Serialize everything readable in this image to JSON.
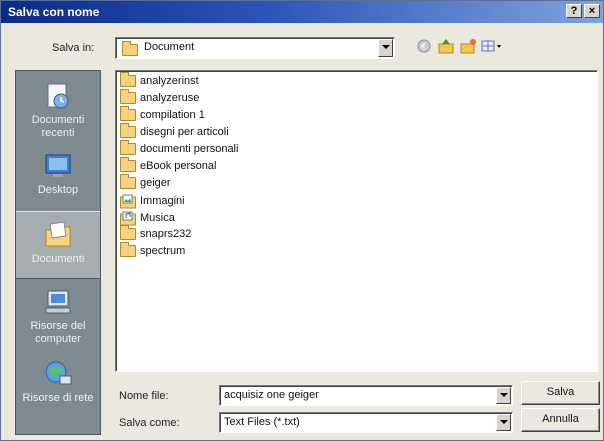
{
  "window": {
    "title": "Salva con nome",
    "help_btn": "?",
    "close_btn": "×"
  },
  "toolbar": {
    "save_in_label": "Salva in:",
    "save_in_value": "Document",
    "icons": [
      "back-icon",
      "up-folder-icon",
      "new-folder-icon",
      "views-menu-icon"
    ]
  },
  "places": [
    {
      "label": "Documenti recenti",
      "icon": "recent-documents-icon"
    },
    {
      "label": "Desktop",
      "icon": "desktop-icon"
    },
    {
      "label": "Documenti",
      "icon": "my-documents-icon"
    },
    {
      "label": "Risorse del computer",
      "icon": "my-computer-icon"
    },
    {
      "label": "Risorse di rete",
      "icon": "network-places-icon"
    }
  ],
  "files": [
    {
      "name": "analyzerinst",
      "icon": "folder-icon"
    },
    {
      "name": "analyzeruse",
      "icon": "folder-icon"
    },
    {
      "name": "compilation 1",
      "icon": "folder-icon"
    },
    {
      "name": "disegni per articoli",
      "icon": "folder-icon"
    },
    {
      "name": "documenti personali",
      "icon": "folder-icon"
    },
    {
      "name": "eBook personal",
      "icon": "folder-icon"
    },
    {
      "name": "geiger",
      "icon": "folder-icon"
    },
    {
      "name": "Immagini",
      "icon": "pictures-folder-icon"
    },
    {
      "name": "Musica",
      "icon": "music-folder-icon"
    },
    {
      "name": "snaprs232",
      "icon": "folder-icon"
    },
    {
      "name": "spectrum",
      "icon": "folder-icon"
    }
  ],
  "filename": {
    "label": "Nome file:",
    "value": "acquisiz one geiger"
  },
  "filetype": {
    "label": "Salva come:",
    "value": "Text Files (*.txt)"
  },
  "buttons": {
    "save": "Salva",
    "cancel": "Annulla"
  }
}
